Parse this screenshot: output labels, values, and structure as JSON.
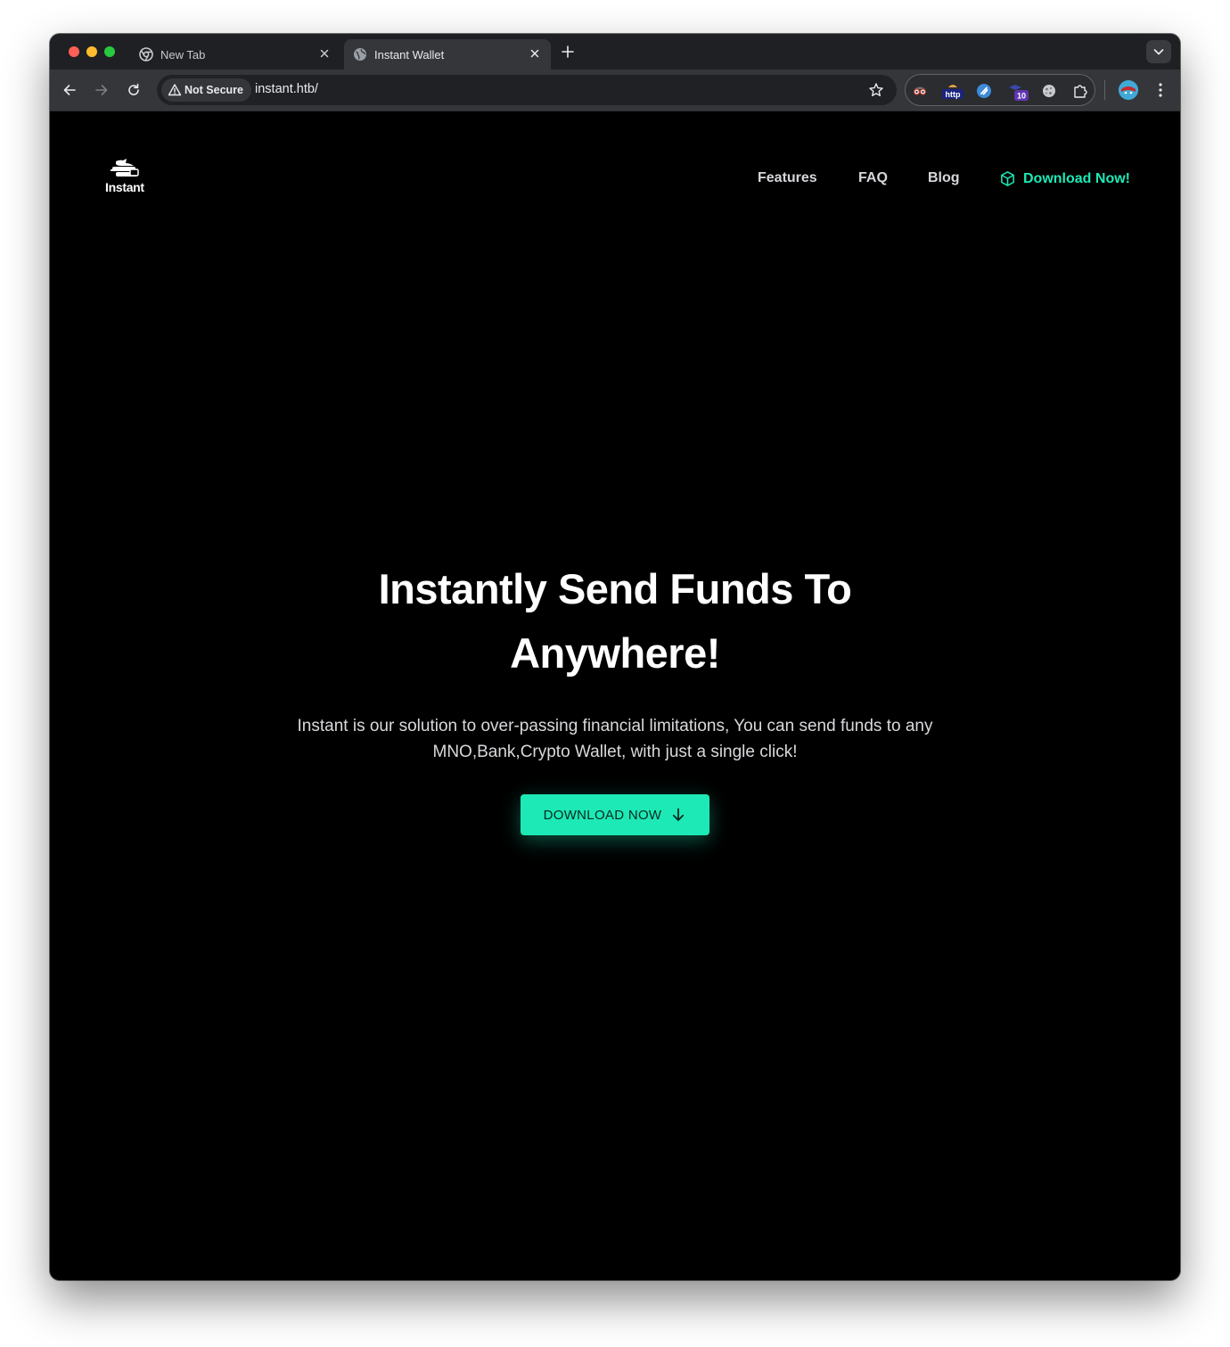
{
  "browser": {
    "tabs": [
      {
        "label": "New Tab",
        "active": false,
        "icon": "chrome-icon"
      },
      {
        "label": "Instant Wallet",
        "active": true,
        "icon": "globe-icon"
      }
    ],
    "address": {
      "security_label": "Not Secure",
      "url": "instant.htb/"
    },
    "extensions": [
      {
        "name": "spy-glasses-extension-icon"
      },
      {
        "name": "http-extension-icon",
        "label": "http"
      },
      {
        "name": "wappalyzer-extension-icon"
      },
      {
        "name": "badge-extension-icon",
        "badge": "10"
      },
      {
        "name": "cookie-extension-icon"
      },
      {
        "name": "puzzle-extensions-icon"
      }
    ]
  },
  "site": {
    "logo_text": "Instant",
    "nav": {
      "features": "Features",
      "faq": "FAQ",
      "blog": "Blog",
      "download": "Download Now!"
    },
    "hero": {
      "title_line1": "Instantly Send Funds To",
      "title_line2": "Anywhere!",
      "subtitle": "Instant is our solution to over-passing financial limitations, You can send funds to any MNO,Bank,Crypto Wallet, with just a single click!",
      "cta": "DOWNLOAD NOW"
    }
  },
  "colors": {
    "accent": "#1de9b6",
    "page_background": "#000000",
    "toolbar": "#35363a",
    "tabstrip": "#1f2023"
  }
}
